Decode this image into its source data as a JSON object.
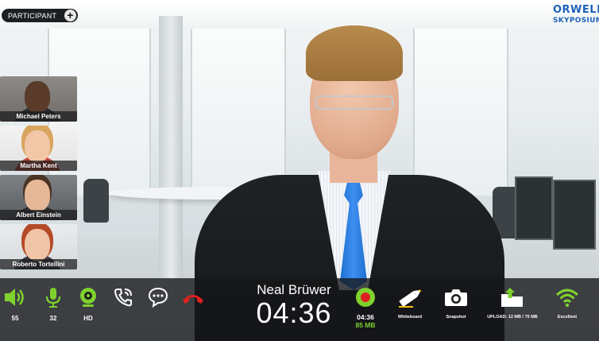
{
  "header": {
    "participant_label": "PARTICIPANT",
    "add_symbol": "+",
    "logo_line1": "ORWELL",
    "logo_line2": "SKYPOSIUM"
  },
  "participants": [
    {
      "name": "Michael Peters"
    },
    {
      "name": "Martha Kent"
    },
    {
      "name": "Albert Einstein"
    },
    {
      "name": "Roberto Tortellini"
    }
  ],
  "caller": {
    "name": "Neal Brüwer",
    "duration": "04:36"
  },
  "controls": {
    "volume": {
      "icon": "speaker-icon",
      "value": "55"
    },
    "mic": {
      "icon": "microphone-icon",
      "value": "32"
    },
    "camera": {
      "icon": "webcam-icon",
      "value": "HD"
    },
    "call": {
      "icon": "phone-ringing-icon"
    },
    "chat": {
      "icon": "chat-bubble-icon"
    },
    "hangup": {
      "icon": "hang-up-icon"
    },
    "record": {
      "icon": "record-icon",
      "time": "04:36",
      "size": "85 MB"
    },
    "whiteboard": {
      "icon": "marker-icon",
      "label": "Whiteboard"
    },
    "snapshot": {
      "icon": "camera-icon",
      "label": "Snapshot"
    },
    "upload": {
      "icon": "folder-upload-icon",
      "label": "UPLOAD: 12 MB / 75 MB"
    },
    "connection": {
      "icon": "wifi-icon",
      "label": "Excellent"
    }
  },
  "colors": {
    "accent_green": "#7fd22e",
    "hangup_red": "#e02020",
    "logo_blue": "#1d62b8"
  }
}
